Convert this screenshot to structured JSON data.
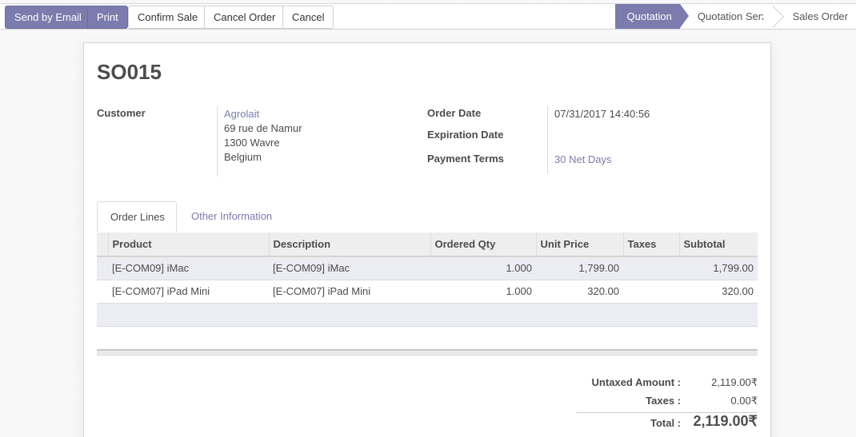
{
  "actions": {
    "send_email": "Send by Email",
    "print": "Print",
    "confirm_sale": "Confirm Sale",
    "cancel_order": "Cancel Order",
    "cancel": "Cancel"
  },
  "stages": [
    "Quotation",
    "Quotation Sent",
    "Sales Order"
  ],
  "order": {
    "name": "SO015",
    "customer_label": "Customer",
    "customer_name": "Agrolait",
    "address": [
      "69 rue de Namur",
      "1300 Wavre",
      "Belgium"
    ],
    "order_date_label": "Order Date",
    "order_date": "07/31/2017 14:40:56",
    "expiration_label": "Expiration Date",
    "payment_terms_label": "Payment Terms",
    "payment_terms": "30 Net Days"
  },
  "tabs": [
    "Order Lines",
    "Other Information"
  ],
  "lines": {
    "columns": [
      "Product",
      "Description",
      "Ordered Qty",
      "Unit Price",
      "Taxes",
      "Subtotal"
    ],
    "rows": [
      {
        "product": "[E-COM09] iMac",
        "description": "[E-COM09] iMac",
        "qty": "1.000",
        "price": "1,799.00",
        "taxes": "",
        "subtotal": "1,799.00"
      },
      {
        "product": "[E-COM07] iPad Mini",
        "description": "[E-COM07] iPad Mini",
        "qty": "1.000",
        "price": "320.00",
        "taxes": "",
        "subtotal": "320.00"
      }
    ]
  },
  "totals": {
    "untaxed_label": "Untaxed Amount :",
    "untaxed": "2,119.00₹",
    "taxes_label": "Taxes :",
    "taxes": "0.00₹",
    "total_label": "Total :",
    "total": "2,119.00₹"
  },
  "colors": {
    "accent": "#7c7bad"
  }
}
